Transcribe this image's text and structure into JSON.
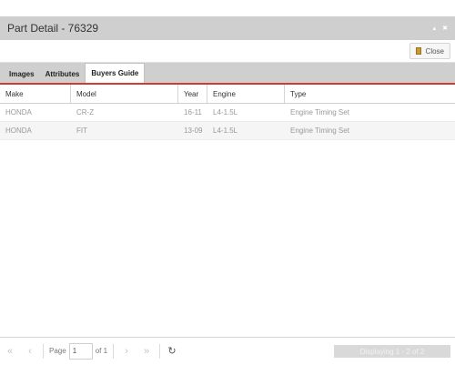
{
  "window": {
    "title": "Part Detail - 76329",
    "tools": {
      "minimize": "▴",
      "close": "✖"
    }
  },
  "toolbar": {
    "close_label": "Close"
  },
  "tabs": [
    {
      "label": "Images",
      "active": false
    },
    {
      "label": "Attributes",
      "active": false
    },
    {
      "label": "Buyers Guide",
      "active": true
    }
  ],
  "grid": {
    "columns": [
      "Make",
      "Model",
      "Year",
      "Engine",
      "Type"
    ],
    "rows": [
      [
        "HONDA",
        "CR-Z",
        "16-11",
        "L4-1.5L",
        "Engine Timing Set"
      ],
      [
        "HONDA",
        "FIT",
        "13-09",
        "L4-1.5L",
        "Engine Timing Set"
      ]
    ]
  },
  "pager": {
    "first_icon": "«",
    "prev_icon": "‹",
    "page_label": "Page",
    "page_value": "1",
    "of_label": "of 1",
    "next_icon": "›",
    "last_icon": "»",
    "refresh_icon": "↻",
    "status": "Displaying 1 - 2 of 2"
  }
}
